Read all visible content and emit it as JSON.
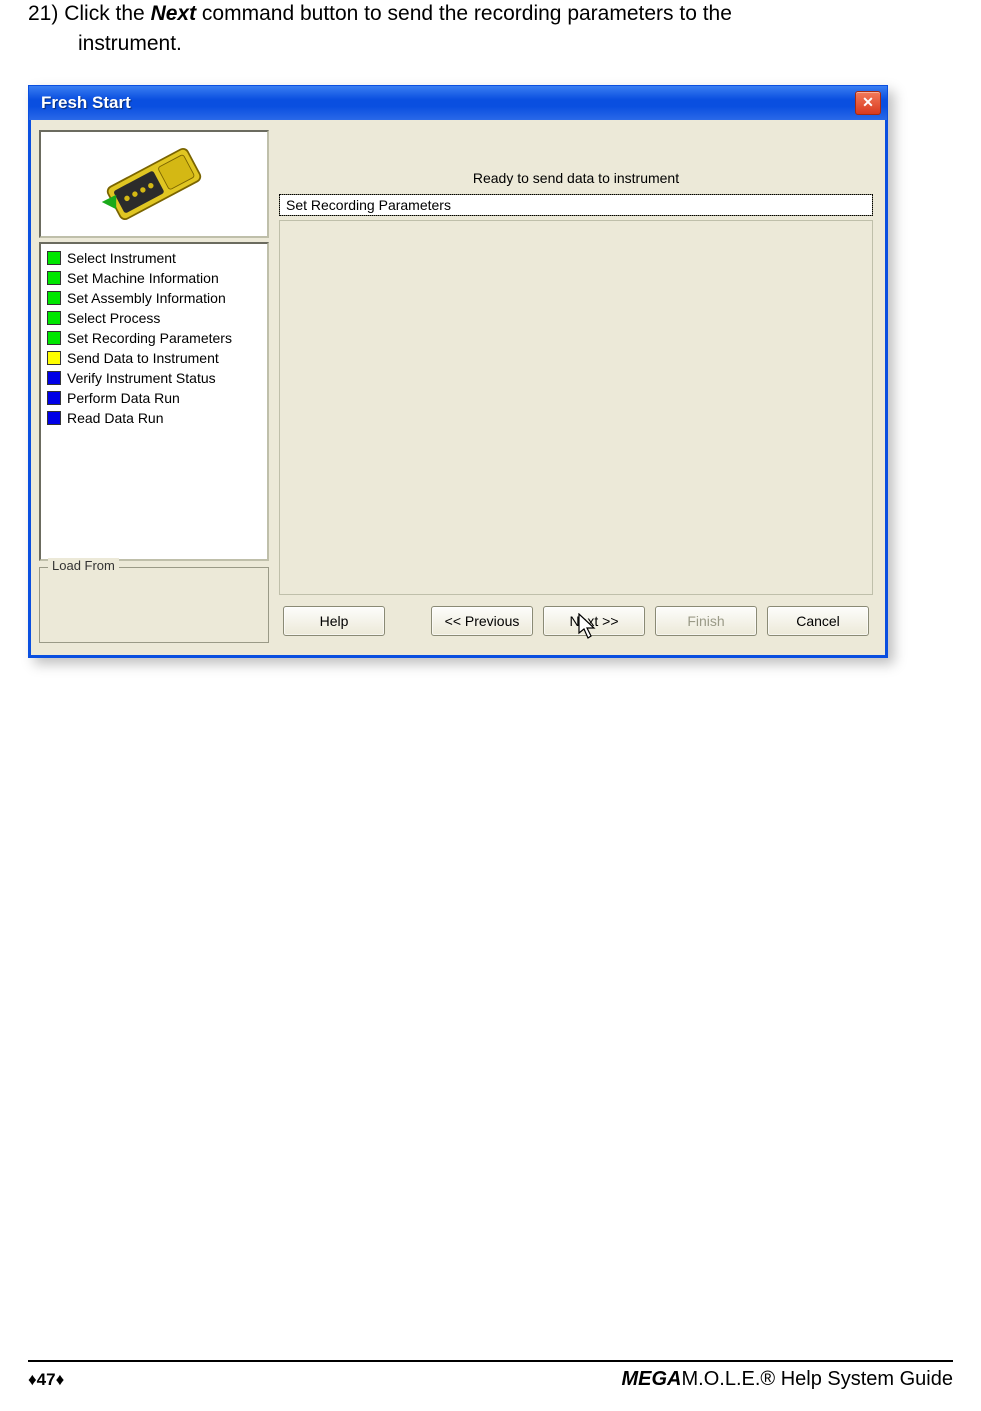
{
  "instruction": {
    "number": "21)",
    "click_the": "Click the ",
    "next": "Next",
    "rest1": " command button to send the recording parameters to the",
    "rest2": "instrument."
  },
  "dialog": {
    "title": "Fresh Start",
    "close_glyph": "✕",
    "steps": [
      {
        "state": "green",
        "label": "Select Instrument"
      },
      {
        "state": "green",
        "label": "Set Machine Information"
      },
      {
        "state": "green",
        "label": "Set Assembly Information"
      },
      {
        "state": "green",
        "label": "Select Process"
      },
      {
        "state": "green",
        "label": "Set Recording Parameters"
      },
      {
        "state": "yellow",
        "label": "Send Data to Instrument"
      },
      {
        "state": "blue",
        "label": "Verify Instrument Status"
      },
      {
        "state": "blue",
        "label": "Perform Data Run"
      },
      {
        "state": "blue",
        "label": "Read Data Run"
      }
    ],
    "loadfrom_label": "Load From",
    "ready_message": "Ready to send data to instrument",
    "field_value": "Set Recording Parameters",
    "buttons": {
      "help": "Help",
      "previous": "<< Previous",
      "next": "Next >>",
      "finish": "Finish",
      "cancel": "Cancel"
    }
  },
  "footer": {
    "page_marker": "♦47♦",
    "guide_prefix": "MEGA",
    "guide_rest": "M.O.L.E.® Help System Guide"
  }
}
